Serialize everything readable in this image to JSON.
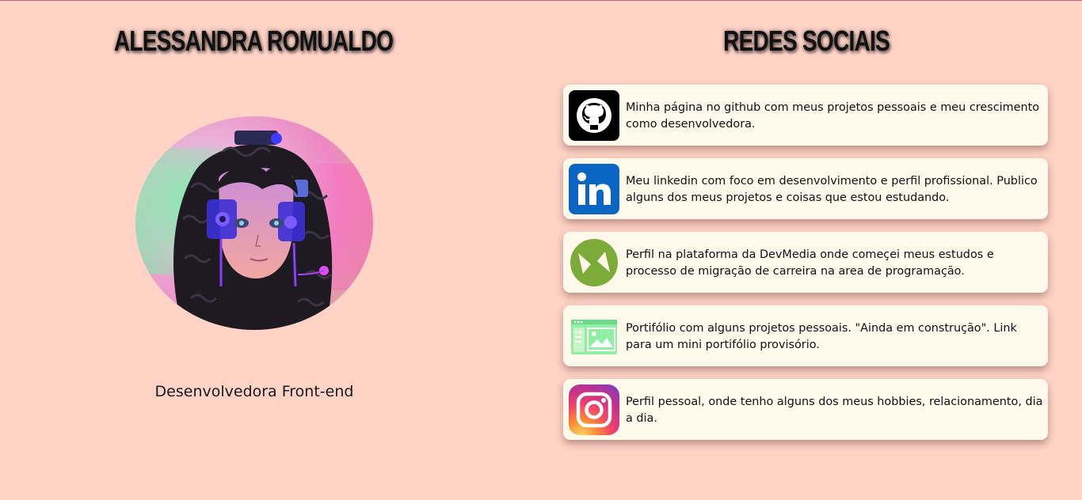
{
  "profile": {
    "name": "ALESSANDRA ROMUALDO",
    "role": "Desenvolvedora Front-end"
  },
  "social": {
    "title": "REDES SOCIAIS",
    "items": [
      {
        "icon": "github-icon",
        "text": "Minha página no github com meus projetos pessoais e meu crescimento como desenvolvedora."
      },
      {
        "icon": "linkedin-icon",
        "text": "Meu linkedin com foco em desenvolvimento e perfil profissional. Publico alguns dos meus projetos e coisas que estou estudando."
      },
      {
        "icon": "devmedia-icon",
        "text": "Perfil na plataforma da DevMedia onde começei meus estudos e processo de migração de carreira na area de programação."
      },
      {
        "icon": "portfolio-icon",
        "text": "Portifólio com alguns projetos pessoais. \"Ainda em construção\". Link para um mini portifólio provisório."
      },
      {
        "icon": "instagram-icon",
        "text": "Perfil pessoal, onde tenho alguns dos meus hobbies, relacionamento, dia a dia."
      }
    ]
  },
  "colors": {
    "background": "#ffd3c6",
    "card": "#fff9ec",
    "linkedin": "#0a66c2",
    "devmedia": "#7cab3a",
    "portfolio": "#8ff0a4"
  }
}
